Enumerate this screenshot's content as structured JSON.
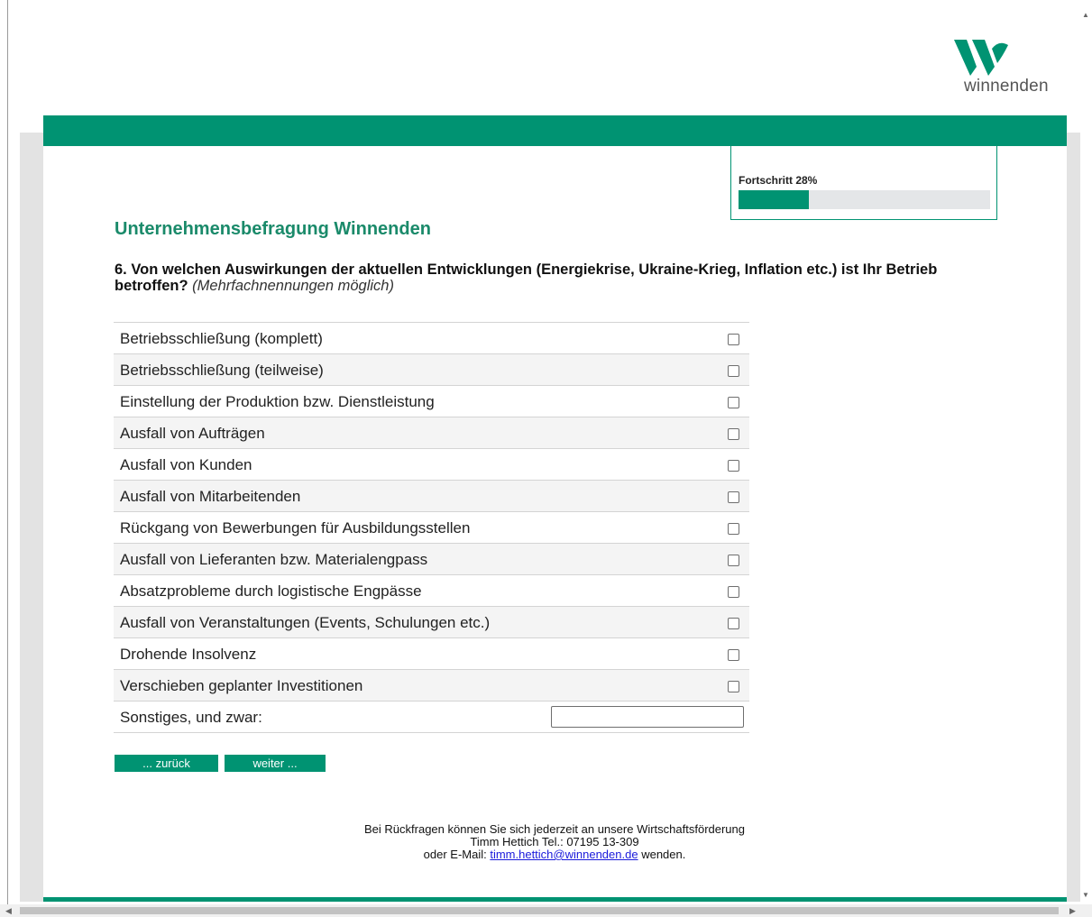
{
  "logo": {
    "text": "winnenden",
    "brand_color": "#009372"
  },
  "progress": {
    "label": "Fortschritt 28%",
    "value": 0.28
  },
  "survey_title": "Unternehmensbefragung Winnenden",
  "question": {
    "text": "6. Von welchen Auswirkungen der aktuellen Entwicklungen (Energiekrise, Ukraine-Krieg, Inflation etc.) ist Ihr Betrieb betroffen?",
    "hint": "(Mehrfachnennungen möglich)"
  },
  "options": [
    {
      "label": "Betriebsschließung (komplett)",
      "checked": false
    },
    {
      "label": "Betriebsschließung (teilweise)",
      "checked": false
    },
    {
      "label": "Einstellung der Produktion bzw. Dienstleistung",
      "checked": false
    },
    {
      "label": "Ausfall von Aufträgen",
      "checked": false
    },
    {
      "label": "Ausfall von Kunden",
      "checked": false
    },
    {
      "label": "Ausfall von Mitarbeitenden",
      "checked": false
    },
    {
      "label": "Rückgang von Bewerbungen für Ausbildungsstellen",
      "checked": false
    },
    {
      "label": "Ausfall von Lieferanten bzw. Materialengpass",
      "checked": false
    },
    {
      "label": "Absatzprobleme durch logistische Engpässe",
      "checked": false
    },
    {
      "label": "Ausfall von Veranstaltungen (Events, Schulungen etc.)",
      "checked": false
    },
    {
      "label": "Drohende Insolvenz",
      "checked": false
    },
    {
      "label": "Verschieben geplanter Investitionen",
      "checked": false
    }
  ],
  "other": {
    "label": "Sonstiges, und zwar:",
    "value": ""
  },
  "buttons": {
    "back": "... zurück",
    "next": "weiter ..."
  },
  "footer": {
    "line1": "Bei Rückfragen können Sie sich jederzeit an unsere Wirtschaftsförderung",
    "line2": "Timm Hettich Tel.: 07195 13-309",
    "line3_prefix": "oder E-Mail:",
    "email": "timm.hettich@winnenden.de",
    "line3_suffix": "wenden."
  }
}
